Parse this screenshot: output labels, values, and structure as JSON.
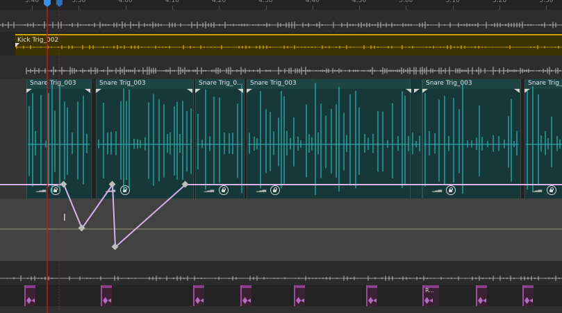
{
  "ruler": {
    "labels": [
      "3:40",
      "3:50",
      "4:00",
      "4:10",
      "4:20",
      "4:30",
      "4:40",
      "4:50",
      "5:00",
      "5:10",
      "5:20",
      "5:30"
    ]
  },
  "kick_track": {
    "clip_name": "Kick Trig_002"
  },
  "snare_track": {
    "clips": [
      {
        "name": "Snare Trig_003"
      },
      {
        "name": "Snare Trig_003"
      },
      {
        "name": "Snare Trig_0..."
      },
      {
        "name": "Snare Trig_003"
      },
      {
        "name": "Snare Trig_003"
      },
      {
        "name": "Snare Trig_..."
      }
    ]
  },
  "bottom_track": {
    "clip_labels": [
      "",
      "",
      "",
      "",
      "",
      "",
      "R...",
      "",
      ""
    ]
  },
  "colors": {
    "kick": "#c9a300",
    "snare_wave": "#2fb8b8",
    "automation": "#d7b2ea",
    "playhead": "#c1191f",
    "pink": "#9b4d9b"
  }
}
